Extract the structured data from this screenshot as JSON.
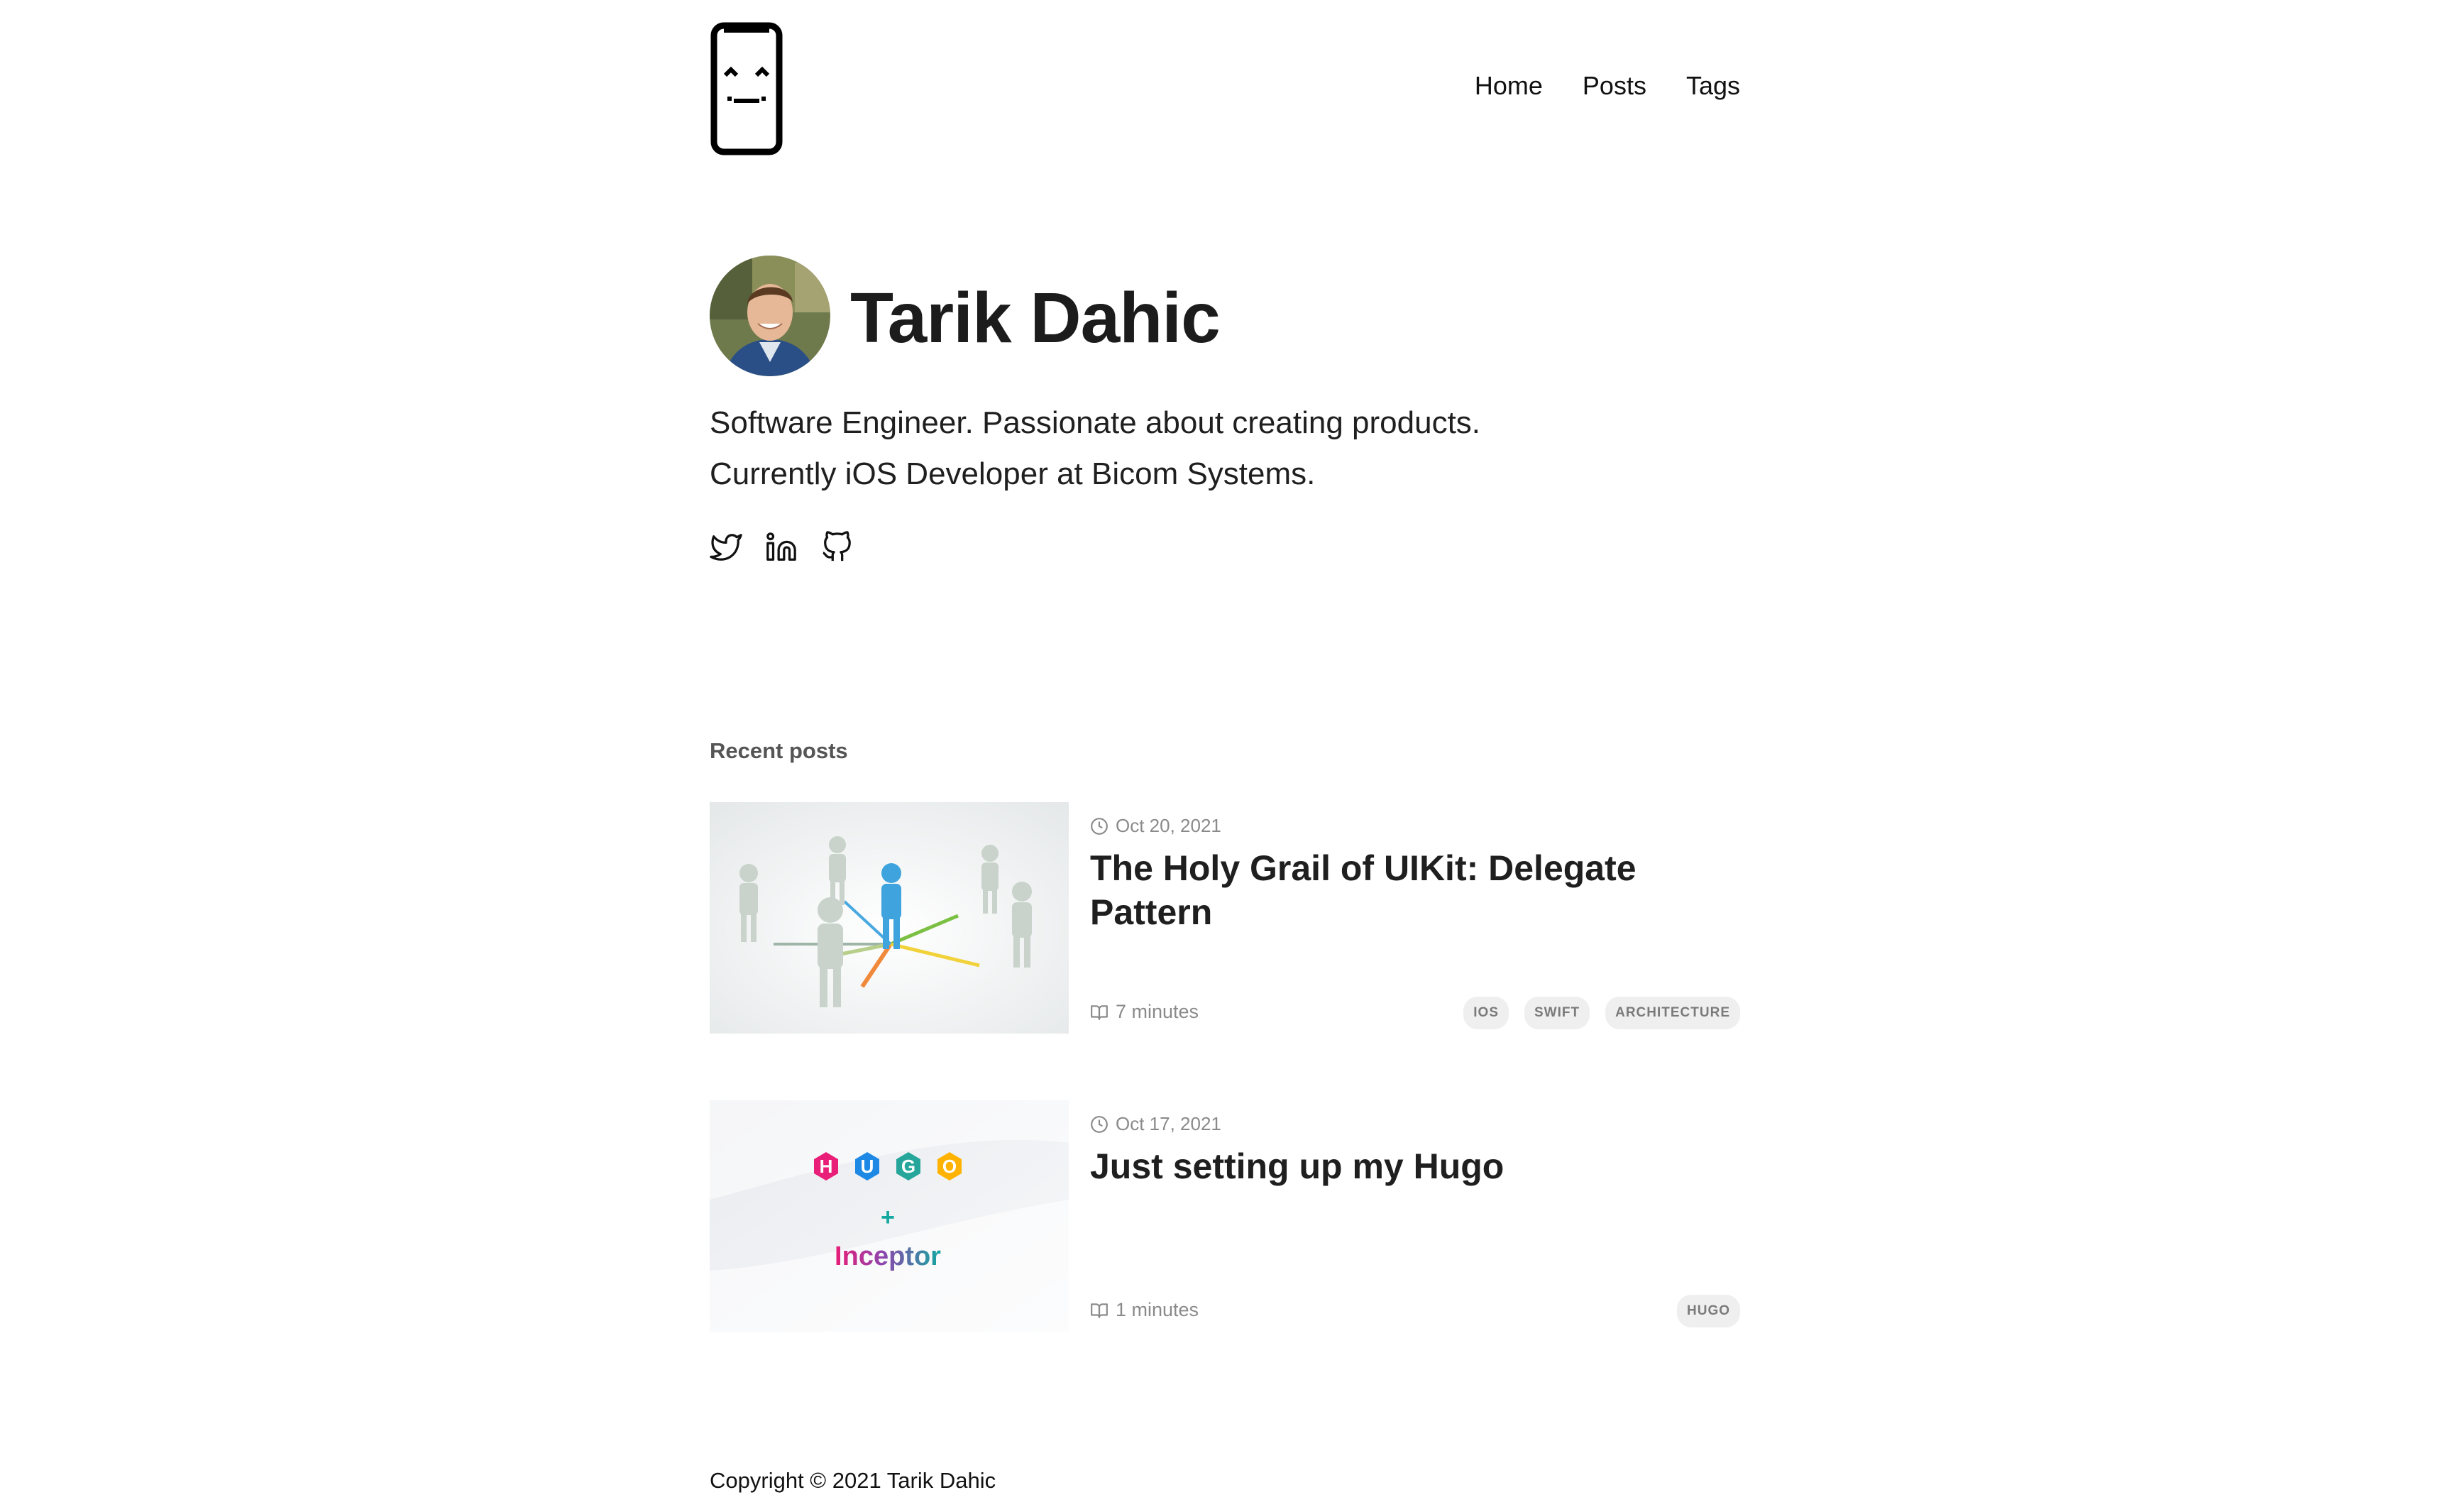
{
  "header": {
    "nav": [
      {
        "label": "Home"
      },
      {
        "label": "Posts"
      },
      {
        "label": "Tags"
      }
    ]
  },
  "profile": {
    "name": "Tarik Dahic",
    "bio_line_1": "Software Engineer. Passionate about creating products.",
    "bio_line_2": "Currently iOS Developer at Bicom Systems.",
    "social_icons": [
      "twitter-icon",
      "linkedin-icon",
      "github-icon"
    ]
  },
  "recent": {
    "heading": "Recent posts",
    "posts": [
      {
        "date": "Oct 20, 2021",
        "title": "The Holy Grail of UIKit: Delegate Pattern",
        "read_time": "7 minutes",
        "tags": [
          "IOS",
          "SWIFT",
          "ARCHITECTURE"
        ]
      },
      {
        "date": "Oct 17, 2021",
        "title": "Just setting up my Hugo",
        "read_time": "1 minutes",
        "tags": [
          "HUGO"
        ],
        "thumb_text": {
          "h": "H",
          "u": "U",
          "g": "G",
          "o": "O",
          "plus": "+",
          "inceptor": "Inceptor"
        }
      }
    ]
  },
  "footer": {
    "copyright": "Copyright © 2021 Tarik Dahic"
  },
  "colors": {
    "text": "#1a1a1a",
    "muted": "#8a8a8a",
    "tag_bg": "#efefef",
    "hugo_pink": "#e91e78",
    "hugo_blue": "#1e88e5",
    "hugo_green": "#26a69a",
    "hugo_orange": "#ffb300"
  }
}
